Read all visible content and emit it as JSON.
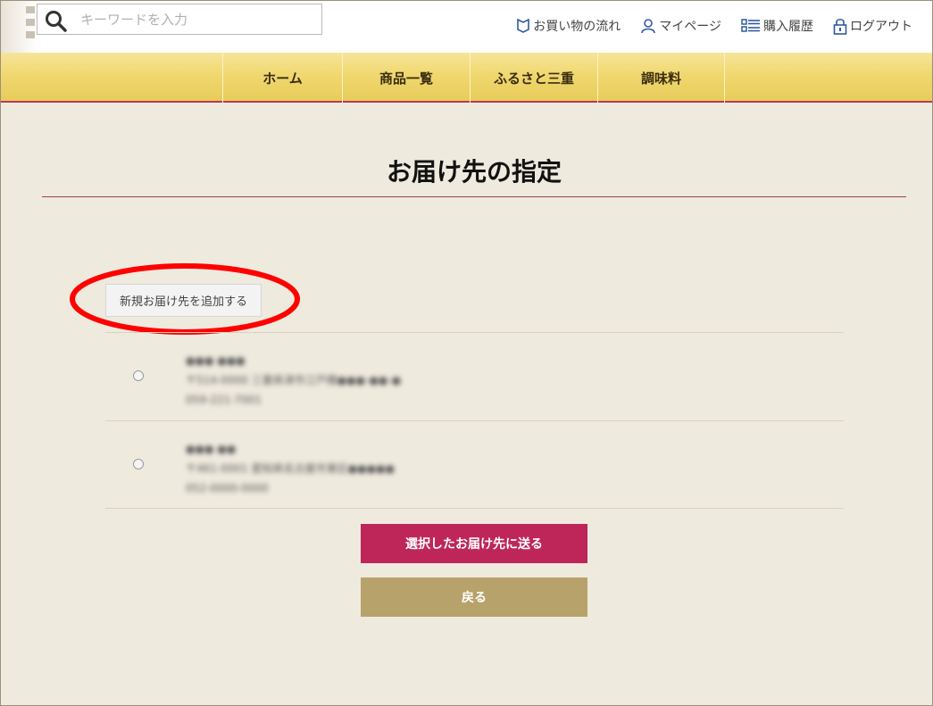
{
  "search": {
    "placeholder": "キーワードを入力",
    "icon": "search-icon"
  },
  "util_nav": [
    {
      "label": "お買い物の流れ",
      "icon": "shopping-flow-icon"
    },
    {
      "label": "マイページ",
      "icon": "user-icon"
    },
    {
      "label": "購入履歴",
      "icon": "list-icon"
    },
    {
      "label": "ログアウト",
      "icon": "lock-icon"
    }
  ],
  "main_nav": [
    {
      "label": "ホーム"
    },
    {
      "label": "商品一覧"
    },
    {
      "label": "ふるさと三重"
    },
    {
      "label": "調味料"
    }
  ],
  "page": {
    "title": "お届け先の指定"
  },
  "actions": {
    "add_address": "新規お届け先を追加する",
    "send_selected": "選択したお届け先に送る",
    "back": "戻る"
  },
  "addresses": [
    {
      "name": "●●● ●●●",
      "address": "〒514-0000 三重県津市江戸橋●●●-●●-●",
      "phone": "059-221-7001"
    },
    {
      "name": "●●● ●●",
      "address": "〒461-0001 愛知県名古屋市東区●●●●●",
      "phone": "052-0000-0000"
    }
  ],
  "colors": {
    "accent": "#be2659",
    "gold": "#b7a26b",
    "nav_gold": "#f0d870",
    "annotation": "#ff0000"
  }
}
